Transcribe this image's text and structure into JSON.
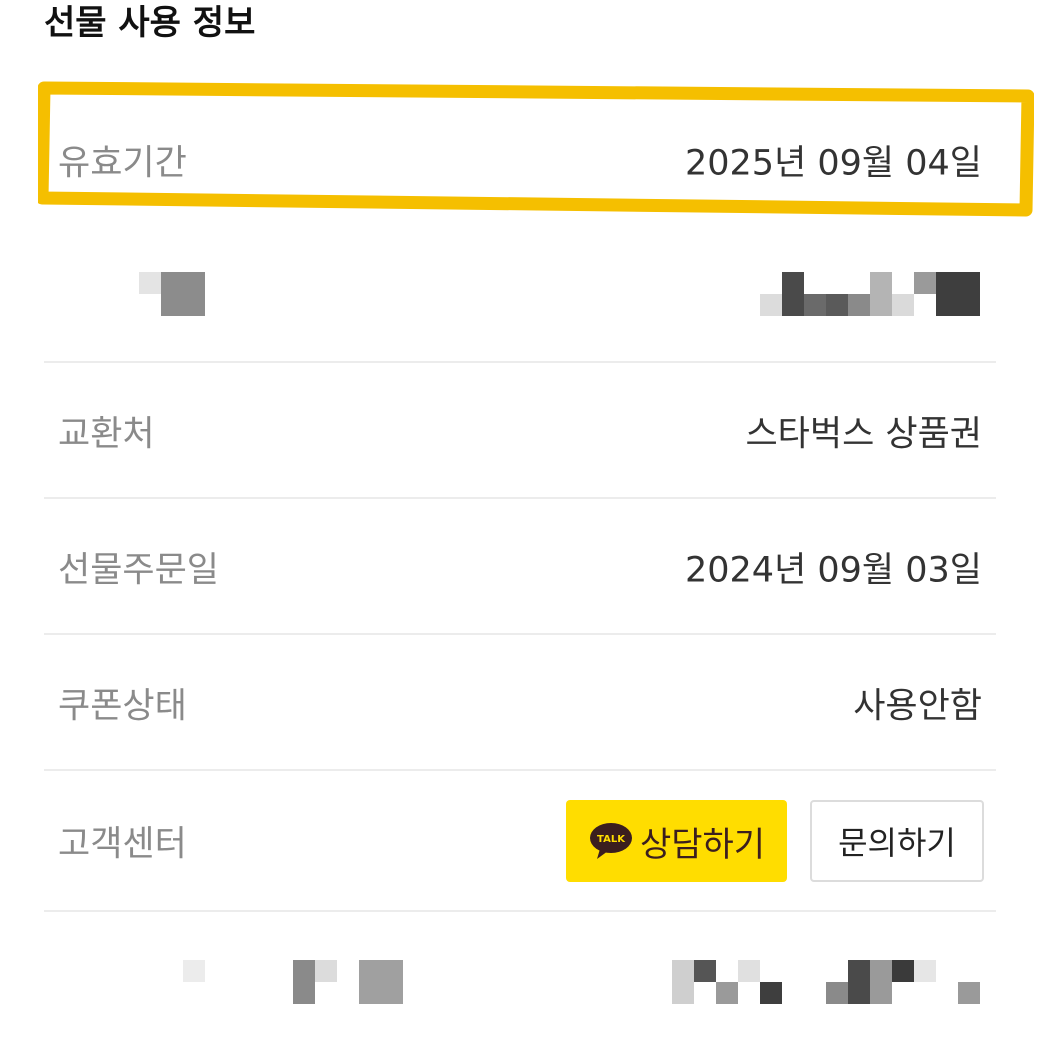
{
  "section": {
    "title": "선물 사용 정보"
  },
  "rows": [
    {
      "label": "유효기간",
      "value": "2025년 09월 04일"
    },
    {
      "label": "교환처",
      "value": "스타벅스 상품권"
    },
    {
      "label": "선물주문일",
      "value": "2024년 09월 03일"
    },
    {
      "label": "쿠폰상태",
      "value": "사용안함"
    },
    {
      "label": "고객센터"
    }
  ],
  "buttons": {
    "talk_badge": "TALK",
    "consult": "상담하기",
    "inquiry": "문의하기"
  },
  "colors": {
    "highlight": "#f5bf00",
    "talk_button": "#ffdd00",
    "talk_bubble": "#3b1e1e"
  }
}
